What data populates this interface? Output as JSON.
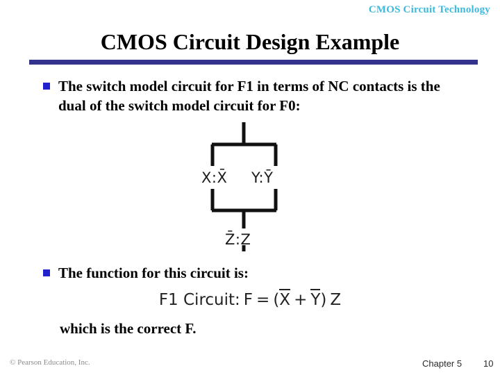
{
  "header": {
    "tag": "CMOS Circuit Technology",
    "tag_color": "#3cb9dd"
  },
  "title": {
    "text": "CMOS Circuit Design Example",
    "rule_color": "#33328c"
  },
  "bullets": [
    {
      "marker": "square-bullet",
      "marker_color": "#2222cc",
      "text": "The switch model circuit for F1 in terms of NC contacts is the dual of the switch model circuit for F0:"
    },
    {
      "marker": "square-bullet",
      "marker_color": "#2222cc",
      "text": "The function for this circuit is:"
    }
  ],
  "closing": {
    "text": "which is the correct F."
  },
  "circuit": {
    "name": "switch-model-circuit-F1",
    "parallel_branches": [
      {
        "label_plain": "X",
        "label_bar": "X",
        "separator": ":"
      },
      {
        "label_plain": "Y",
        "label_bar": "Y",
        "separator": ":"
      }
    ],
    "series_element": {
      "label_bar": "Z",
      "label_plain": "Z",
      "separator": ":"
    },
    "labels": {
      "left_branch": "X:X̄",
      "right_branch": "Y:Ȳ",
      "series": "Z̄:Z"
    },
    "wire_color": "#111111"
  },
  "equation": {
    "prefix": "F1 Circuit:",
    "lhs": "F",
    "equals": "=",
    "open_paren": "(",
    "term1": "X",
    "plus": "+",
    "term2": "Y",
    "close_paren": ")",
    "term3": "Z",
    "full_text": "F1 Circuit: F = (X̄ + Ȳ) Z"
  },
  "footer": {
    "copyright": "© Pearson Education, Inc.",
    "chapter": "Chapter 5",
    "page": "10"
  }
}
